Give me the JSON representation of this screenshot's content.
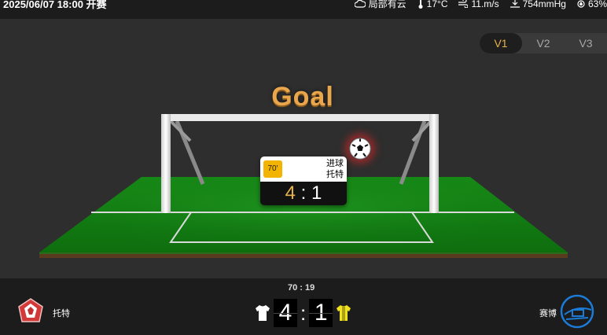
{
  "header": {
    "datetime": "2025/06/07 18:00 开赛",
    "weather": {
      "condition": "局部有云",
      "temperature": "17°C",
      "wind": "11.m/s",
      "pressure": "754mmHg",
      "humidity": "63%"
    }
  },
  "versions": [
    "V1",
    "V2",
    "V3"
  ],
  "active_version": "V1",
  "animation": {
    "title": "Goal",
    "event": {
      "minute": "70'",
      "type": "进球",
      "team": "托特",
      "home_score": "4",
      "separator": ":",
      "away_score": "1"
    }
  },
  "match": {
    "clock": "70 : 19",
    "home": {
      "name": "托特",
      "score": "4",
      "kit_color": "#ffffff"
    },
    "away": {
      "name": "赛博",
      "score": "1",
      "kit_color": "#f2e21b"
    },
    "separator": ":"
  },
  "colors": {
    "accent": "#e8b24a",
    "pitch": "#1f8a1f",
    "card_minute": "#f2b400"
  }
}
